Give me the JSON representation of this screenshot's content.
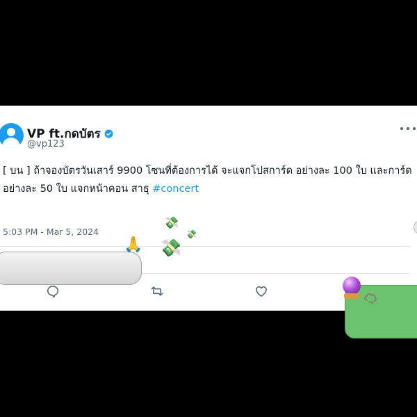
{
  "tweet": {
    "display_name": "VP ft.กดบัตร",
    "handle": "@vp123",
    "text_line1": "[ บน ] ถ้าจองบัตรวันเสาร์ 9900 โซนที่ต้องการได้ จะแจกโปสการ์ด อย่างละ 100 ใบ และการ์ด",
    "text_line2_prefix": "อย่างละ 50 ใบ แจกหน้าคอน สาธุ ",
    "hashtag": "#concert",
    "timestamp": "5:03 PM - Mar 5, 2024"
  },
  "icons": {
    "pray": "🙏",
    "money_with_wings": "💸"
  },
  "colors": {
    "link_blue": "#1d9bf0",
    "text_primary": "#0f1419",
    "text_secondary": "#536471",
    "bubble_green": "#6cc36f",
    "background": "#000000"
  }
}
